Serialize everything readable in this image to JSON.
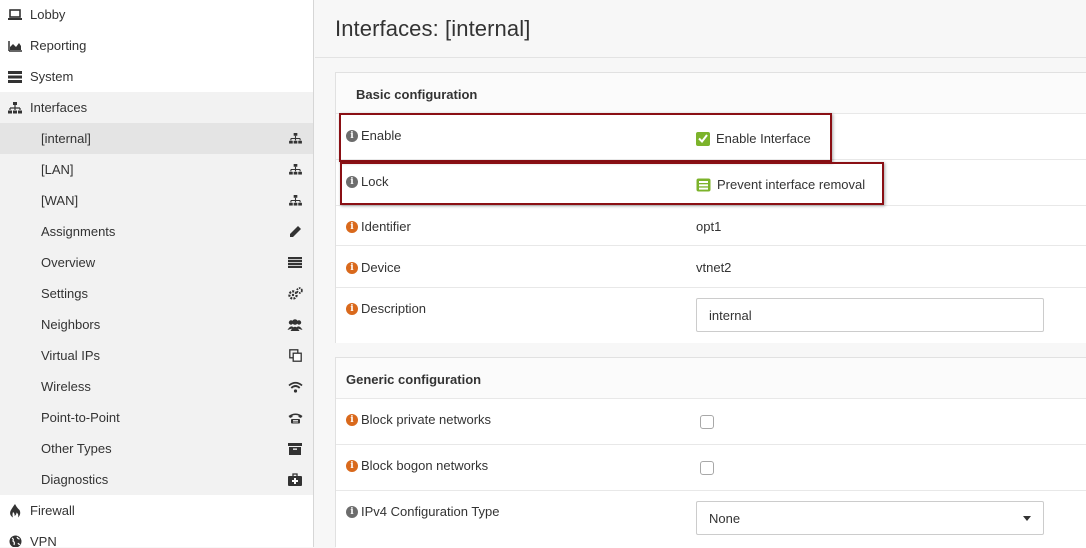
{
  "sidebar": {
    "top_items": [
      {
        "label": "Lobby",
        "icon": "laptop-icon"
      },
      {
        "label": "Reporting",
        "icon": "area-chart-icon"
      },
      {
        "label": "System",
        "icon": "server-icon"
      },
      {
        "label": "Interfaces",
        "icon": "sitemap-icon"
      }
    ],
    "interfaces_items": [
      {
        "label": "[internal]",
        "icon": "sitemap-icon"
      },
      {
        "label": "[LAN]",
        "icon": "sitemap-icon"
      },
      {
        "label": "[WAN]",
        "icon": "sitemap-icon"
      },
      {
        "label": "Assignments",
        "icon": "pencil-icon"
      },
      {
        "label": "Overview",
        "icon": "list-icon"
      },
      {
        "label": "Settings",
        "icon": "gears-icon"
      },
      {
        "label": "Neighbors",
        "icon": "users-icon"
      },
      {
        "label": "Virtual IPs",
        "icon": "clone-icon"
      },
      {
        "label": "Wireless",
        "icon": "wifi-icon"
      },
      {
        "label": "Point-to-Point",
        "icon": "phone-icon"
      },
      {
        "label": "Other Types",
        "icon": "archive-icon"
      },
      {
        "label": "Diagnostics",
        "icon": "medkit-icon"
      }
    ],
    "bottom_items": [
      {
        "label": "Firewall",
        "icon": "fire-icon"
      },
      {
        "label": "VPN",
        "icon": "globe-icon"
      }
    ]
  },
  "page": {
    "title": "Interfaces: [internal]"
  },
  "basic": {
    "title": "Basic configuration",
    "enable_label": "Enable",
    "enable_value": "Enable Interface",
    "lock_label": "Lock",
    "lock_value": "Prevent interface removal",
    "identifier_label": "Identifier",
    "identifier_value": "opt1",
    "device_label": "Device",
    "device_value": "vtnet2",
    "description_label": "Description",
    "description_value": "internal"
  },
  "generic": {
    "title": "Generic configuration",
    "block_private_label": "Block private networks",
    "block_private_checked": false,
    "block_bogon_label": "Block bogon networks",
    "block_bogon_checked": false,
    "ipv4_type_label": "IPv4 Configuration Type",
    "ipv4_type_value": "None"
  },
  "colors": {
    "highlight_border": "#8a0f14",
    "info_orange": "#d9691c",
    "info_grey": "#6c6c6c",
    "check_green": "#7cb32b"
  }
}
